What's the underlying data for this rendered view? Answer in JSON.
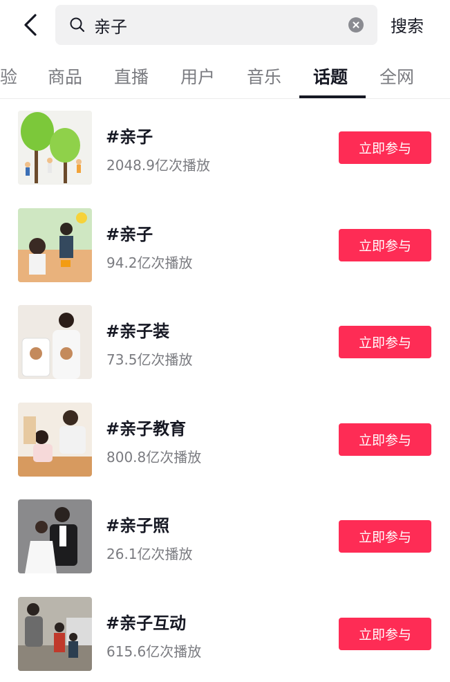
{
  "search": {
    "value": "亲子",
    "button_label": "搜索"
  },
  "tabs": [
    {
      "label": "验"
    },
    {
      "label": "商品"
    },
    {
      "label": "直播"
    },
    {
      "label": "用户"
    },
    {
      "label": "音乐"
    },
    {
      "label": "话题",
      "active": true
    },
    {
      "label": "全网"
    }
  ],
  "topics": [
    {
      "title": "#亲子",
      "plays": "2048.9亿次播放",
      "button": "立即参与"
    },
    {
      "title": "#亲子",
      "plays": "94.2亿次播放",
      "button": "立即参与"
    },
    {
      "title": "#亲子装",
      "plays": "73.5亿次播放",
      "button": "立即参与"
    },
    {
      "title": "#亲子教育",
      "plays": "800.8亿次播放",
      "button": "立即参与"
    },
    {
      "title": "#亲子照",
      "plays": "26.1亿次播放",
      "button": "立即参与"
    },
    {
      "title": "#亲子互动",
      "plays": "615.6亿次播放",
      "button": "立即参与"
    }
  ],
  "colors": {
    "accent": "#fe2c55",
    "text": "#161823",
    "muted": "#7a7b80"
  },
  "icons": {
    "back": "chevron-left-icon",
    "search": "search-icon",
    "clear": "clear-icon"
  }
}
